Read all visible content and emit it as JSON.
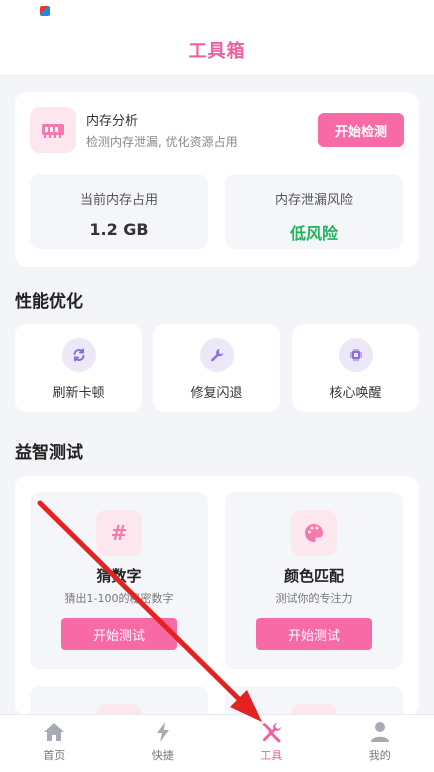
{
  "header": {
    "title": "工具箱"
  },
  "memory": {
    "title": "内存分析",
    "desc": "检测内存泄漏, 优化资源占用",
    "button": "开始检测",
    "stats": [
      {
        "label": "当前内存占用",
        "value": "1.2 GB"
      },
      {
        "label": "内存泄漏风险",
        "value": "低风险"
      }
    ]
  },
  "performance": {
    "title": "性能优化",
    "items": [
      {
        "label": "刷新卡顿",
        "icon": "refresh-icon"
      },
      {
        "label": "修复闪退",
        "icon": "wrench-icon"
      },
      {
        "label": "核心唤醒",
        "icon": "chip-icon"
      }
    ]
  },
  "quiz": {
    "title": "益智测试",
    "items": [
      {
        "title": "猜数字",
        "desc": "猜出1-100的秘密数字",
        "button": "开始测试",
        "icon": "hash-icon"
      },
      {
        "title": "颜色匹配",
        "desc": "测试你的专注力",
        "button": "开始测试",
        "icon": "palette-icon"
      }
    ]
  },
  "tabs": [
    {
      "label": "首页",
      "icon": "home-icon"
    },
    {
      "label": "快捷",
      "icon": "lightning-icon"
    },
    {
      "label": "工具",
      "icon": "tools-icon",
      "active": true
    },
    {
      "label": "我的",
      "icon": "person-icon"
    }
  ],
  "colors": {
    "accent": "#f86aa6",
    "low_risk": "#22b35e",
    "title_pink": "#f0609f",
    "arrow": "#e32222"
  }
}
